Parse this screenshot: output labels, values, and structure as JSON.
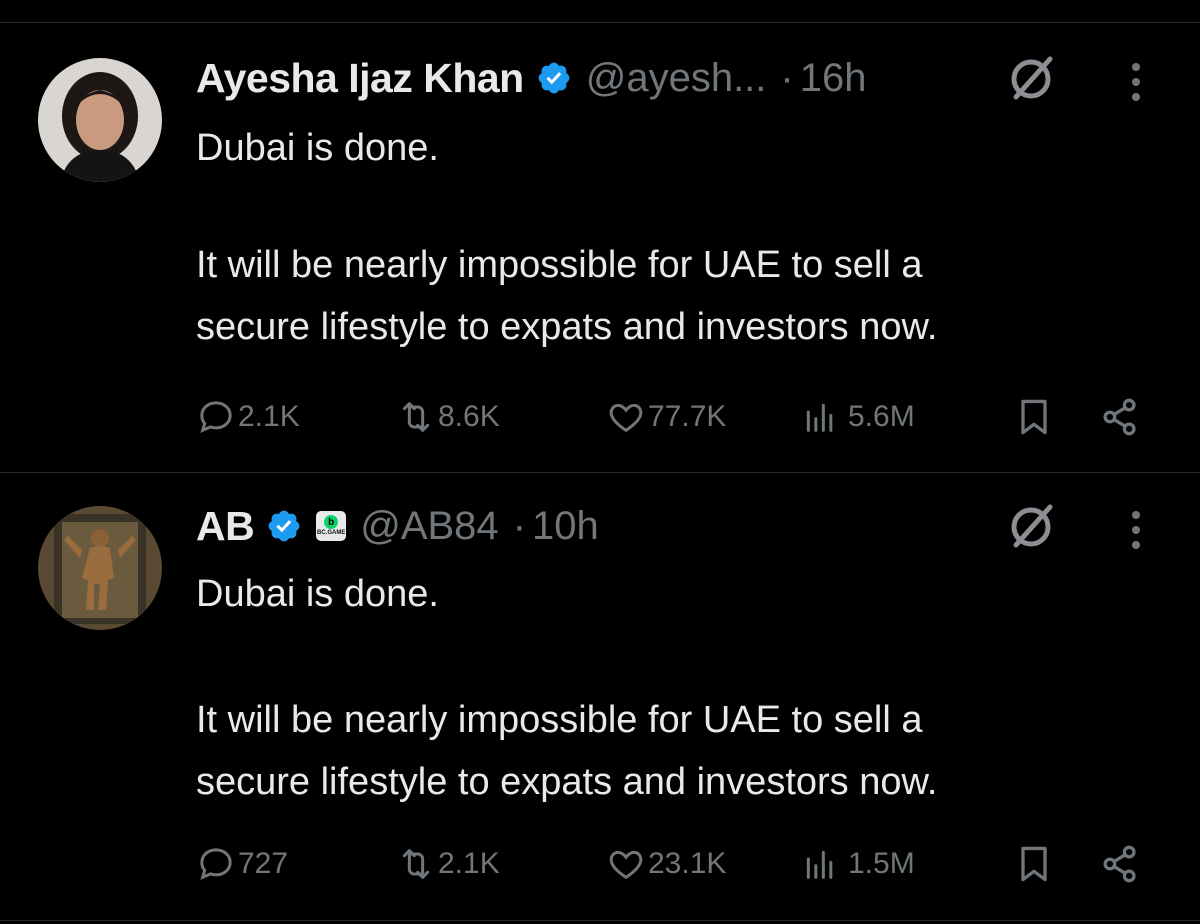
{
  "tweets": [
    {
      "display_name": "Ayesha Ijaz Khan",
      "verified": true,
      "handle": "@ayesh...",
      "separator": "·",
      "time": "16h",
      "body": [
        "Dubai is done.",
        "It will be nearly impossible for UAE to sell a secure lifestyle to expats and investors now."
      ],
      "body_line2_a": "It will be nearly impossible for UAE to sell a",
      "body_line2_b": "secure lifestyle to expats and investors now.",
      "stats": {
        "replies": "2.1K",
        "reposts": "8.6K",
        "likes": "77.7K",
        "views": "5.6M"
      }
    },
    {
      "display_name": "AB",
      "verified": true,
      "affiliate_badge": {
        "letter": "b",
        "text": "BC.GAME"
      },
      "handle": "@AB84",
      "separator": "·",
      "time": "10h",
      "body": [
        "Dubai is done.",
        "It will be nearly impossible for UAE to sell a secure lifestyle to expats and investors now."
      ],
      "body_line2_a": "It will be nearly impossible for UAE to sell a",
      "body_line2_b": "secure lifestyle to expats and investors now.",
      "stats": {
        "replies": "727",
        "reposts": "2.1K",
        "likes": "23.1K",
        "views": "1.5M"
      }
    }
  ],
  "icons": {
    "reply": "comment-icon",
    "repost": "repost-icon",
    "like": "heart-icon",
    "views": "bar-chart-icon",
    "bookmark": "bookmark-icon",
    "share": "share-icon",
    "grok": "grok-icon",
    "more": "more-dots-icon"
  },
  "colors": {
    "background": "#000000",
    "text": "#e7e9ea",
    "muted": "#71767b",
    "verified": "#1d9bf0",
    "divider": "#2a2d31"
  }
}
